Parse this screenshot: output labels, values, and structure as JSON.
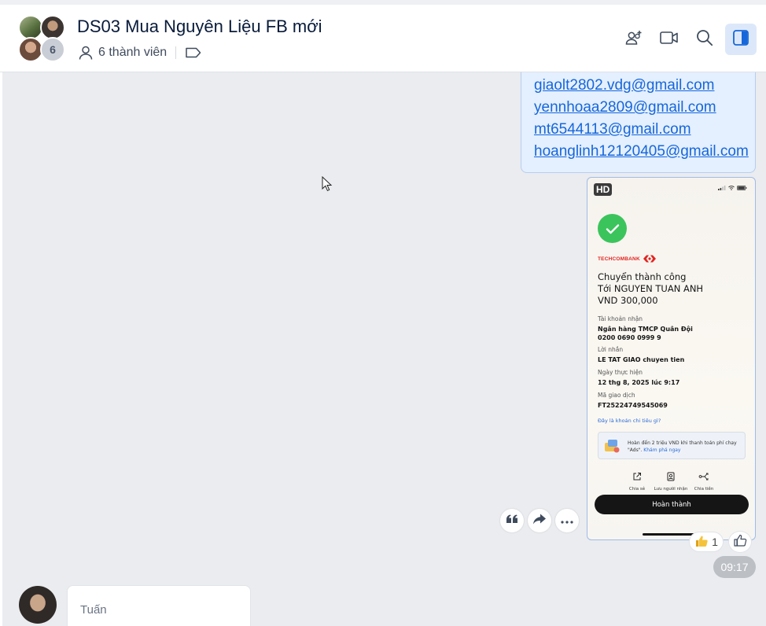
{
  "header": {
    "title": "DS03 Mua Nguyên Liệu FB mới",
    "member_count_badge": "6",
    "members_label": "6 thành viên"
  },
  "header_actions": {
    "add_member_icon": "person-add-icon",
    "video_icon": "video-camera-icon",
    "search_icon": "search-icon",
    "panel_icon": "sidebar-panel-icon"
  },
  "messages": {
    "emails": [
      "giaolt2802.vdg@gmail.com",
      "yennhoaa2809@gmail.com",
      "mt6544113@gmail.com",
      "hoanglinh12120405@gmail.com"
    ],
    "image": {
      "hd_badge": "HD",
      "receipt": {
        "bank": "TECHCOMBANK",
        "status_line1": "Chuyển thành công",
        "status_line2": "Tới NGUYEN TUAN ANH",
        "amount": "VND 300,000",
        "account_label": "Tài khoản nhận",
        "account_bank": "Ngân hàng TMCP Quân Đội",
        "account_number": "0200 0690 0999 9",
        "note_label": "Lời nhắn",
        "note_value": "LE TAT GIAO chuyen tien",
        "date_label": "Ngày thực hiện",
        "date_value": "12 thg 8, 2025 lúc 9:17",
        "txn_label": "Mã giao dịch",
        "txn_value": "FT25224749545069",
        "spend_link": "Đây là khoản chi tiêu gì?",
        "promo_text_line1": "Hoàn đến 2 triệu VND khi thanh toán phí chạy",
        "promo_text_line2a": "\"Ads\". ",
        "promo_text_link": "Khám phá ngay",
        "action_share": "Chia sẻ",
        "action_save": "Lưu người nhận",
        "action_split": "Chia tiền",
        "done_button": "Hoàn thành"
      }
    },
    "reaction_count": "1",
    "time": "09:17",
    "next_sender": "Tuấn"
  },
  "colors": {
    "accent": "#1667d9",
    "email_bubble_bg": "#e4efff",
    "chat_bg": "#eaecef",
    "success_green": "#3cc45c",
    "techcombank_red": "#e3231f"
  }
}
